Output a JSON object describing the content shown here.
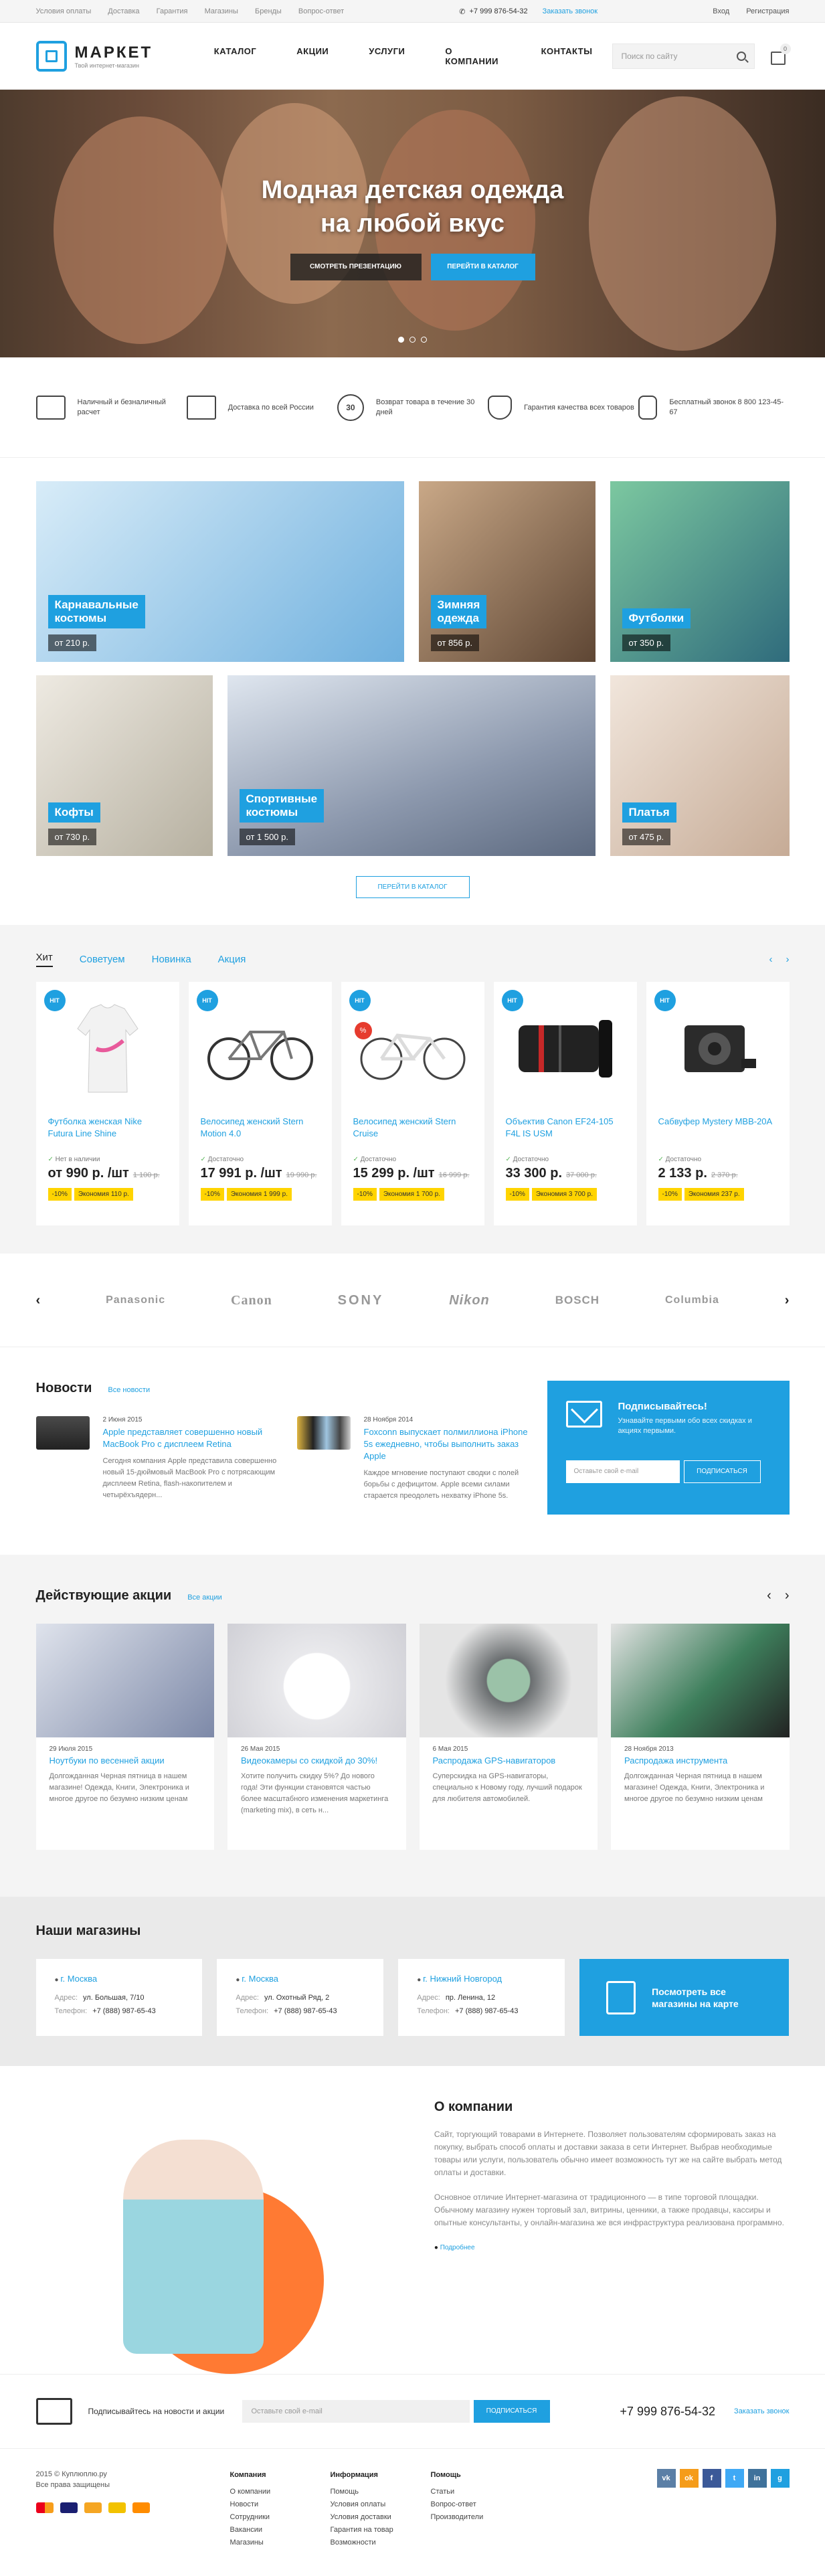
{
  "topbar": {
    "links": [
      "Условия оплаты",
      "Доставка",
      "Гарантия",
      "Магазины",
      "Бренды",
      "Вопрос-ответ"
    ],
    "phone": "+7 999 876-54-32",
    "callback": "Заказать звонок",
    "login": "Вход",
    "register": "Регистрация"
  },
  "header": {
    "logo_name": "МАРКЕТ",
    "logo_sub": "Твой интернет-магазин",
    "nav": [
      "Каталог",
      "Акции",
      "Услуги",
      "О компании",
      "Контакты"
    ],
    "search_placeholder": "Поиск по сайту",
    "cart_count": "0"
  },
  "hero": {
    "title_line1": "Модная детская одежда",
    "title_line2": "на любой вкус",
    "btn_presentation": "Смотреть презентацию",
    "btn_catalog": "Перейти в каталог"
  },
  "features": [
    {
      "icon": "card-icon",
      "text": "Наличный и безналичный расчет"
    },
    {
      "icon": "truck-icon",
      "text": "Доставка по всей России"
    },
    {
      "icon": "return-icon",
      "text": "Возврат товара в течение 30 дней"
    },
    {
      "icon": "quality-icon",
      "text": "Гарантия качества всех товаров"
    },
    {
      "icon": "phone-icon",
      "text": "Бесплатный звонок 8 800 123-45-67"
    }
  ],
  "feature_30": "30",
  "categories": [
    {
      "label": "Карнавальные\nкостюмы",
      "price": "от 210 р.",
      "color": "#8fc6ea"
    },
    {
      "label": "Зимняя\nодежда",
      "price": "от 856 р.",
      "color": "#b08a6a"
    },
    {
      "label": "Футболки",
      "price": "от 350 р.",
      "color": "#5fae7a"
    },
    {
      "label": "Кофты",
      "price": "от 730 р.",
      "color": "#d7d7cf"
    },
    {
      "label": "Спортивные\nкостюмы",
      "price": "от 1 500 р.",
      "color": "#9aa6b8"
    },
    {
      "label": "Платья",
      "price": "от 475 р.",
      "color": "#d9c7b8"
    }
  ],
  "catalog_button": "Перейти в каталог",
  "products": {
    "tabs": [
      "Хит",
      "Советуем",
      "Новинка",
      "Акция"
    ],
    "items": [
      {
        "badge": "HIT",
        "name": "Футболка женская Nike Futura Line Shine",
        "avail": "Нет в наличии",
        "price": "от 990 р. /шт",
        "old": "1 100 р.",
        "discount": "-10%",
        "economy": "Экономия 110 р."
      },
      {
        "badge": "HIT",
        "name": "Велосипед женский Stern Motion 4.0",
        "avail": "Достаточно",
        "price": "17 991 р. /шт",
        "old": "19 990 р.",
        "discount": "-10%",
        "economy": "Экономия 1 999 р."
      },
      {
        "badge": "HIT",
        "pct": "%",
        "name": "Велосипед женский Stern Cruise",
        "avail": "Достаточно",
        "price": "15 299 р. /шт",
        "old": "16 999 р.",
        "discount": "-10%",
        "economy": "Экономия 1 700 р."
      },
      {
        "badge": "HIT",
        "name": "Объектив Canon EF24-105 F4L IS USM",
        "avail": "Достаточно",
        "price": "33 300 р.",
        "old": "37 000 р.",
        "discount": "-10%",
        "economy": "Экономия 3 700 р."
      },
      {
        "badge": "HIT",
        "name": "Сабвуфер Mystery MBB-20A",
        "avail": "Достаточно",
        "price": "2 133 р.",
        "old": "2 370 р.",
        "discount": "-10%",
        "economy": "Экономия 237 р."
      }
    ]
  },
  "brands": [
    "Panasonic",
    "Canon",
    "SONY",
    "Nikon",
    "BOSCH",
    "Columbia"
  ],
  "news": {
    "title": "Новости",
    "all": "Все новости",
    "items": [
      {
        "date": "2 Июня 2015",
        "title": "Apple представляет совершенно новый MacBook Pro с дисплеем Retina",
        "text": "Сегодня компания Apple представила совершенно новый 15-дюймовый MacBook Pro с потрясающим дисплеем Retina, flash-накопителем и четырёхъядерн..."
      },
      {
        "date": "28 Ноября 2014",
        "title": "Foxconn выпускает полмиллиона iPhone 5s ежедневно, чтобы выполнить заказ Apple",
        "text": "Каждое мгновение поступают сводки с полей борьбы с дефицитом. Apple всеми силами старается преодолеть нехватку iPhone 5s."
      }
    ]
  },
  "subscribe": {
    "title": "Подписывайтесь!",
    "text": "Узнавайте первыми обо всех скидках и акциях первыми.",
    "placeholder": "Оставьте свой e-mail",
    "button": "Подписаться"
  },
  "promos": {
    "title": "Действующие акции",
    "all": "Все акции",
    "items": [
      {
        "date": "29 Июля 2015",
        "title": "Ноутбуки по весенней акции",
        "text": "Долгожданная Черная пятница в нашем магазине! Одежда, Книги, Электроника и многое другое по безумно низким ценам",
        "color": "#7d89a8"
      },
      {
        "date": "26 Мая 2015",
        "title": "Видеокамеры со скидкой до 30%!",
        "text": "Хотите получить скидку 5%? До нового года! Эти функции становятся частью более масштабного изменения маркетинга (marketing mix), в сеть н...",
        "color": "#e9e9ec"
      },
      {
        "date": "6 Мая 2015",
        "title": "Распродажа GPS-навигаторов",
        "text": "Суперскидка на GPS-навигаторы, специально к Новому году, лучший подарок для любителя автомобилей.",
        "color": "#6a6e70"
      },
      {
        "date": "28 Ноября 2013",
        "title": "Распродажа инструмента",
        "text": "Долгожданная Черная пятница в нашем магазине! Одежда, Книги, Электроника и многое другое по безумно низким ценам",
        "color": "#3e7f5c"
      }
    ]
  },
  "stores": {
    "title": "Наши магазины",
    "addr_label": "Адрес:",
    "phone_label": "Телефон:",
    "items": [
      {
        "city": "г. Москва",
        "address": "ул. Большая, 7/10",
        "phone": "+7 (888) 987-65-43"
      },
      {
        "city": "г. Москва",
        "address": "ул. Охотный Ряд, 2",
        "phone": "+7 (888) 987-65-43"
      },
      {
        "city": "г. Нижний Новгород",
        "address": "пр. Ленина, 12",
        "phone": "+7 (888) 987-65-43"
      }
    ],
    "map_text": "Посмотреть все магазины на карте"
  },
  "about": {
    "title": "О компании",
    "p1": "Сайт, торгующий товарами в Интернете. Позволяет пользователям сформировать заказ на покупку, выбрать способ оплаты и доставки заказа в сети Интернет. Выбрав необходимые товары или услуги, пользователь обычно имеет возможность тут же на сайте выбрать метод оплаты и доставки.",
    "p2": "Основное отличие Интернет-магазина от традиционного — в типе торговой площадки. Обычному магазину нужен торговый зал, витрины, ценники, а также продавцы, кассиры и опытные консультанты, у онлайн-магазина же вся инфраструктура реализована программно.",
    "more": "Подробнее"
  },
  "footer": {
    "sub_text": "Подписывайтесь на новости и акции",
    "placeholder": "Оставьте свой e-mail",
    "button": "Подписаться",
    "phone": "+7 999 876-54-32",
    "callback": "Заказать звонок",
    "copyright": "2015 © Куплюплю.ру",
    "rights": "Все права защищены",
    "cols": [
      {
        "title": "Компания",
        "items": [
          "О компании",
          "Новости",
          "Сотрудники",
          "Вакансии",
          "Магазины"
        ]
      },
      {
        "title": "Информация",
        "items": [
          "Помощь",
          "Условия оплаты",
          "Условия доставки",
          "Гарантия на товар",
          "Возможности"
        ]
      },
      {
        "title": "Помощь",
        "items": [
          "Статьи",
          "Вопрос-ответ",
          "Производители"
        ]
      }
    ],
    "socials": [
      {
        "label": "vk",
        "color": "#5b7fa6"
      },
      {
        "label": "ok",
        "color": "#f59c1a"
      },
      {
        "label": "f",
        "color": "#3b5998"
      },
      {
        "label": "t",
        "color": "#3fa9f5"
      },
      {
        "label": "in",
        "color": "#3f729b"
      },
      {
        "label": "g",
        "color": "#1fa0e0"
      }
    ]
  }
}
